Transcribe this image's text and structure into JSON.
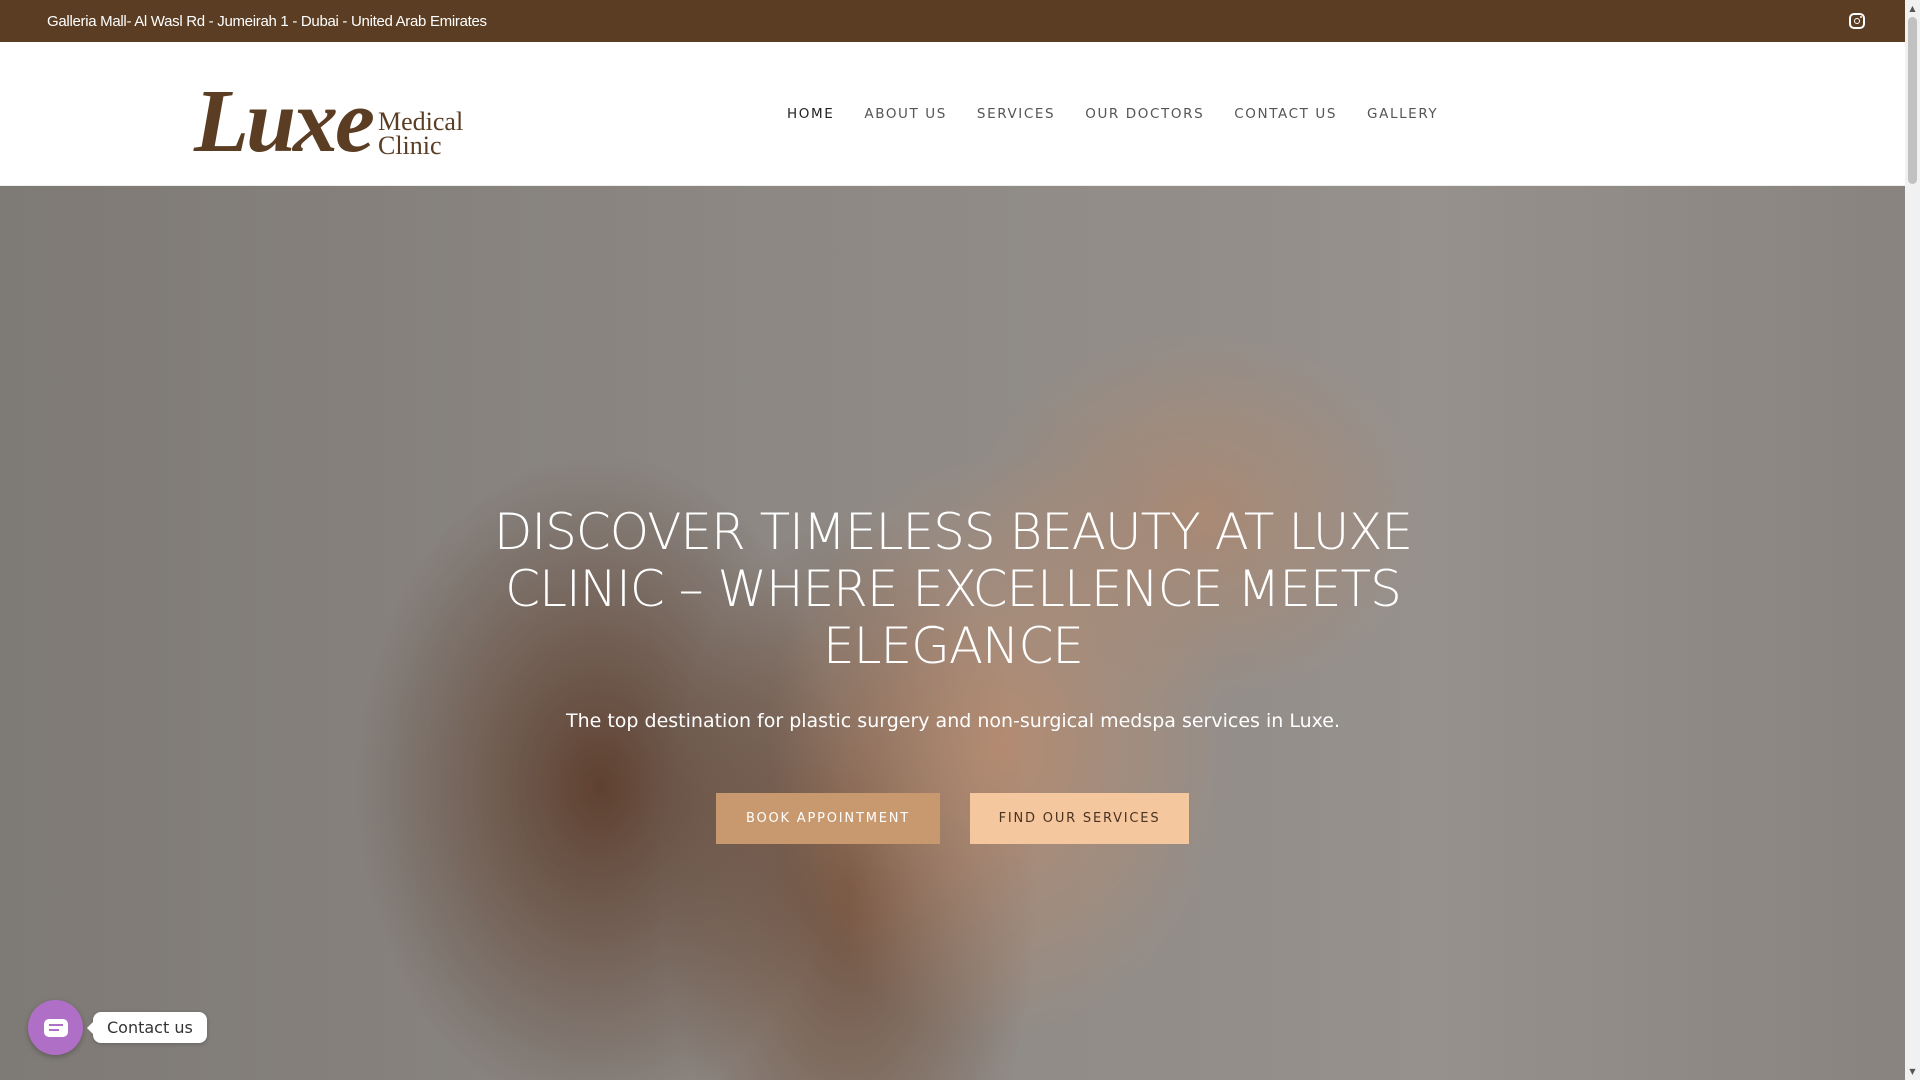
{
  "topbar": {
    "address": "Galleria Mall- Al Wasl Rd - Jumeirah 1 - Dubai - United Arab Emirates",
    "social_icon": "instagram-icon"
  },
  "header": {
    "logo_main": "Luxe",
    "logo_sub_line1": "Medical",
    "logo_sub_line2": "Clinic",
    "nav": [
      {
        "label": "HOME",
        "active": true
      },
      {
        "label": "ABOUT US"
      },
      {
        "label": "SERVICES"
      },
      {
        "label": "OUR DOCTORS"
      },
      {
        "label": "CONTACT US"
      },
      {
        "label": "GALLERY"
      }
    ]
  },
  "hero": {
    "title": "DISCOVER TIMELESS BEAUTY AT LUXE CLINIC – WHERE EXCELLENCE MEETS ELEGANCE",
    "subtitle": "The top destination for plastic surgery and non-surgical medspa services in Luxe.",
    "primary_button": "BOOK APPOINTMENT",
    "secondary_button": "FIND OUR SERVICES"
  },
  "contact_widget": {
    "label": "Contact us",
    "icon": "chat-icon"
  },
  "colors": {
    "brand_brown": "#5a3d22",
    "button_primary": "#c8996e",
    "button_secondary": "#f4c79f",
    "widget_purple": "#b06fc6"
  }
}
